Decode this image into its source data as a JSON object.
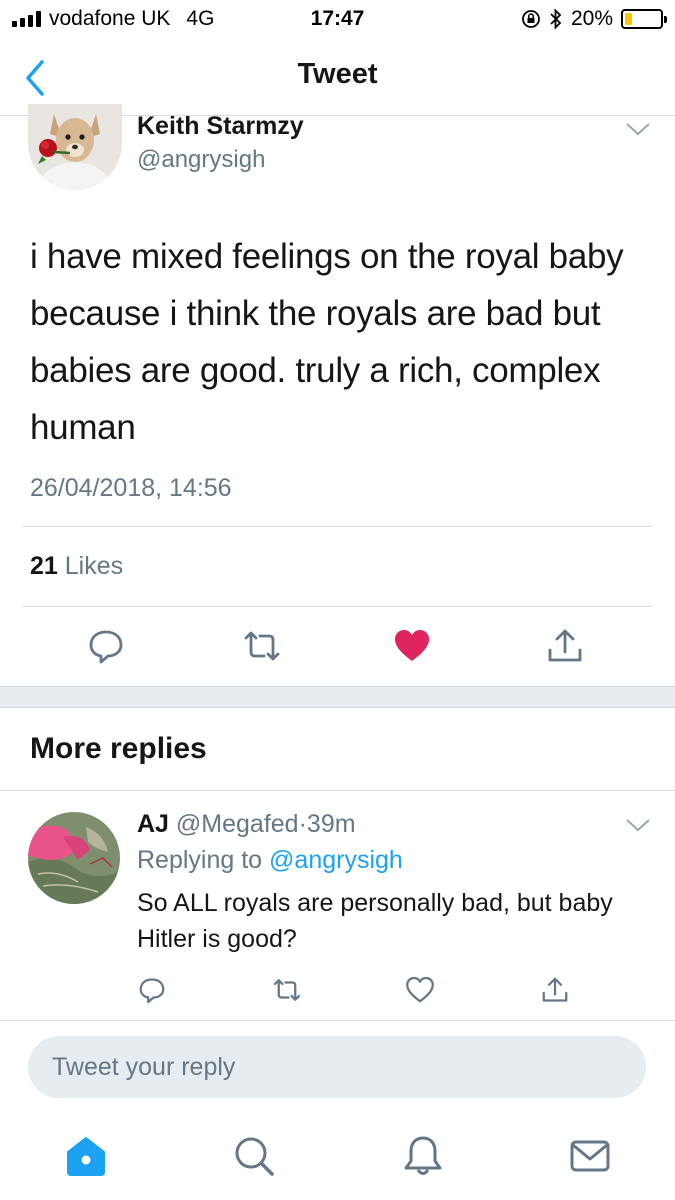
{
  "status_bar": {
    "carrier": "vodafone UK",
    "network": "4G",
    "time": "17:47",
    "battery_percent": "20%",
    "battery_level": 0.2
  },
  "header": {
    "title": "Tweet"
  },
  "tweet": {
    "author_name": "Keith Starmzy",
    "author_handle": "@angrysigh",
    "text": "i have mixed feelings on the royal baby because i think the royals are bad but babies are good. truly a rich, complex human",
    "timestamp": "26/04/2018, 14:56",
    "likes_count": "21",
    "likes_label": "Likes",
    "liked": true
  },
  "more_replies": {
    "title": "More replies"
  },
  "reply": {
    "author_name": "AJ",
    "author_handle": "@Megafed",
    "separator": "·",
    "time_ago": "39m",
    "replying_to_label": "Replying to",
    "replying_to_handle": "@angrysigh",
    "text": "So ALL royals are personally bad, but baby Hitler is good?"
  },
  "composer": {
    "placeholder": "Tweet your reply"
  },
  "tab_bar": {
    "items": [
      {
        "icon": "home-icon",
        "active": true
      },
      {
        "icon": "search-icon",
        "active": false
      },
      {
        "icon": "bell-icon",
        "active": false
      },
      {
        "icon": "mail-icon",
        "active": false
      }
    ]
  },
  "colors": {
    "accent": "#1da1f2",
    "like": "#e0245e",
    "secondary_text": "#657786",
    "divider": "#d8dde2"
  }
}
